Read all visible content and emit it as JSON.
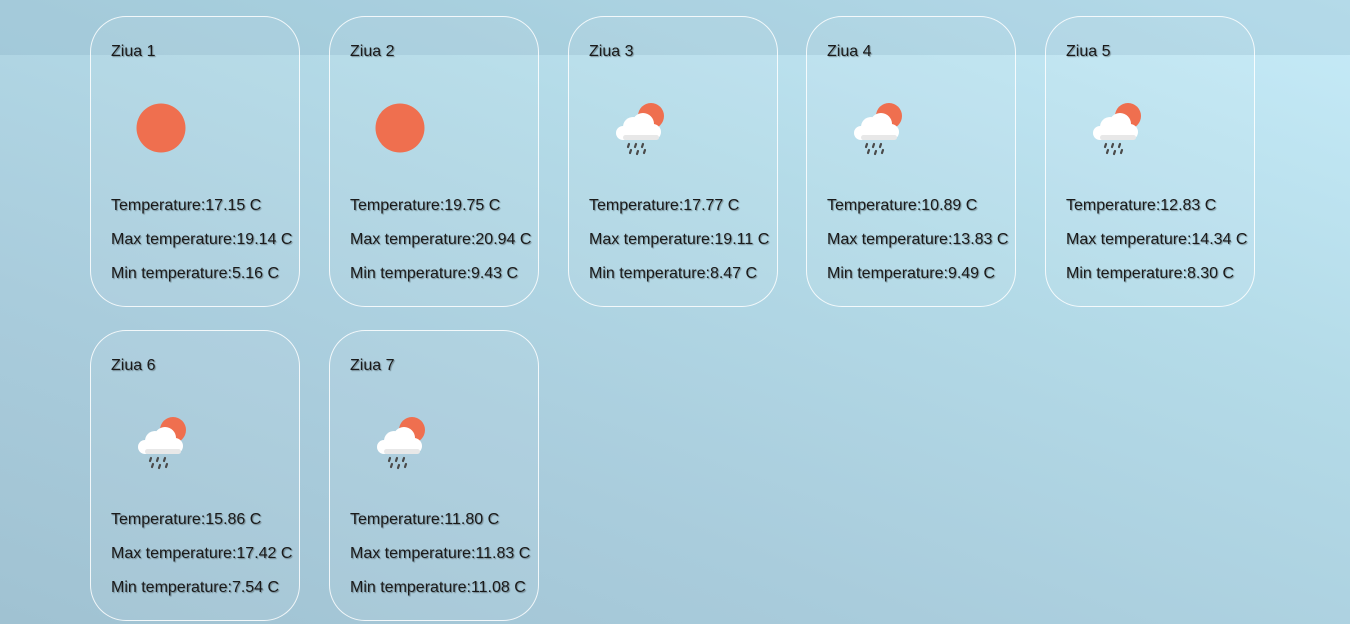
{
  "days": [
    {
      "title": "Ziua 1",
      "icon": "sun-icon",
      "temp_label": "Temperature:",
      "temp": "17.15 C",
      "max_label": "Max temperature:",
      "max": "19.14 C",
      "min_label": "Min temperature:",
      "min": "5.16 C"
    },
    {
      "title": "Ziua 2",
      "icon": "sun-icon",
      "temp_label": "Temperature:",
      "temp": "19.75 C",
      "max_label": "Max temperature:",
      "max": "20.94 C",
      "min_label": "Min temperature:",
      "min": "9.43 C"
    },
    {
      "title": "Ziua 3",
      "icon": "sun-cloud-rain-icon",
      "temp_label": "Temperature:",
      "temp": "17.77 C",
      "max_label": "Max temperature:",
      "max": "19.11 C",
      "min_label": "Min temperature:",
      "min": "8.47 C"
    },
    {
      "title": "Ziua 4",
      "icon": "sun-cloud-rain-icon",
      "temp_label": "Temperature:",
      "temp": "10.89 C",
      "max_label": "Max temperature:",
      "max": "13.83 C",
      "min_label": "Min temperature:",
      "min": "9.49 C"
    },
    {
      "title": "Ziua 5",
      "icon": "sun-cloud-rain-icon",
      "temp_label": "Temperature:",
      "temp": "12.83 C",
      "max_label": "Max temperature:",
      "max": "14.34 C",
      "min_label": "Min temperature:",
      "min": "8.30 C"
    },
    {
      "title": "Ziua 6",
      "icon": "sun-cloud-rain-icon",
      "temp_label": "Temperature:",
      "temp": "15.86 C",
      "max_label": "Max temperature:",
      "max": "17.42 C",
      "min_label": "Min temperature:",
      "min": "7.54 C"
    },
    {
      "title": "Ziua 7",
      "icon": "sun-cloud-rain-icon",
      "temp_label": "Temperature:",
      "temp": "11.80 C",
      "max_label": "Max temperature:",
      "max": "11.83 C",
      "min_label": "Min temperature:",
      "min": "11.08 C"
    }
  ],
  "colors": {
    "sun": "#ef6f4f",
    "cloud": "#f2f2f2",
    "rain": "#555555"
  }
}
